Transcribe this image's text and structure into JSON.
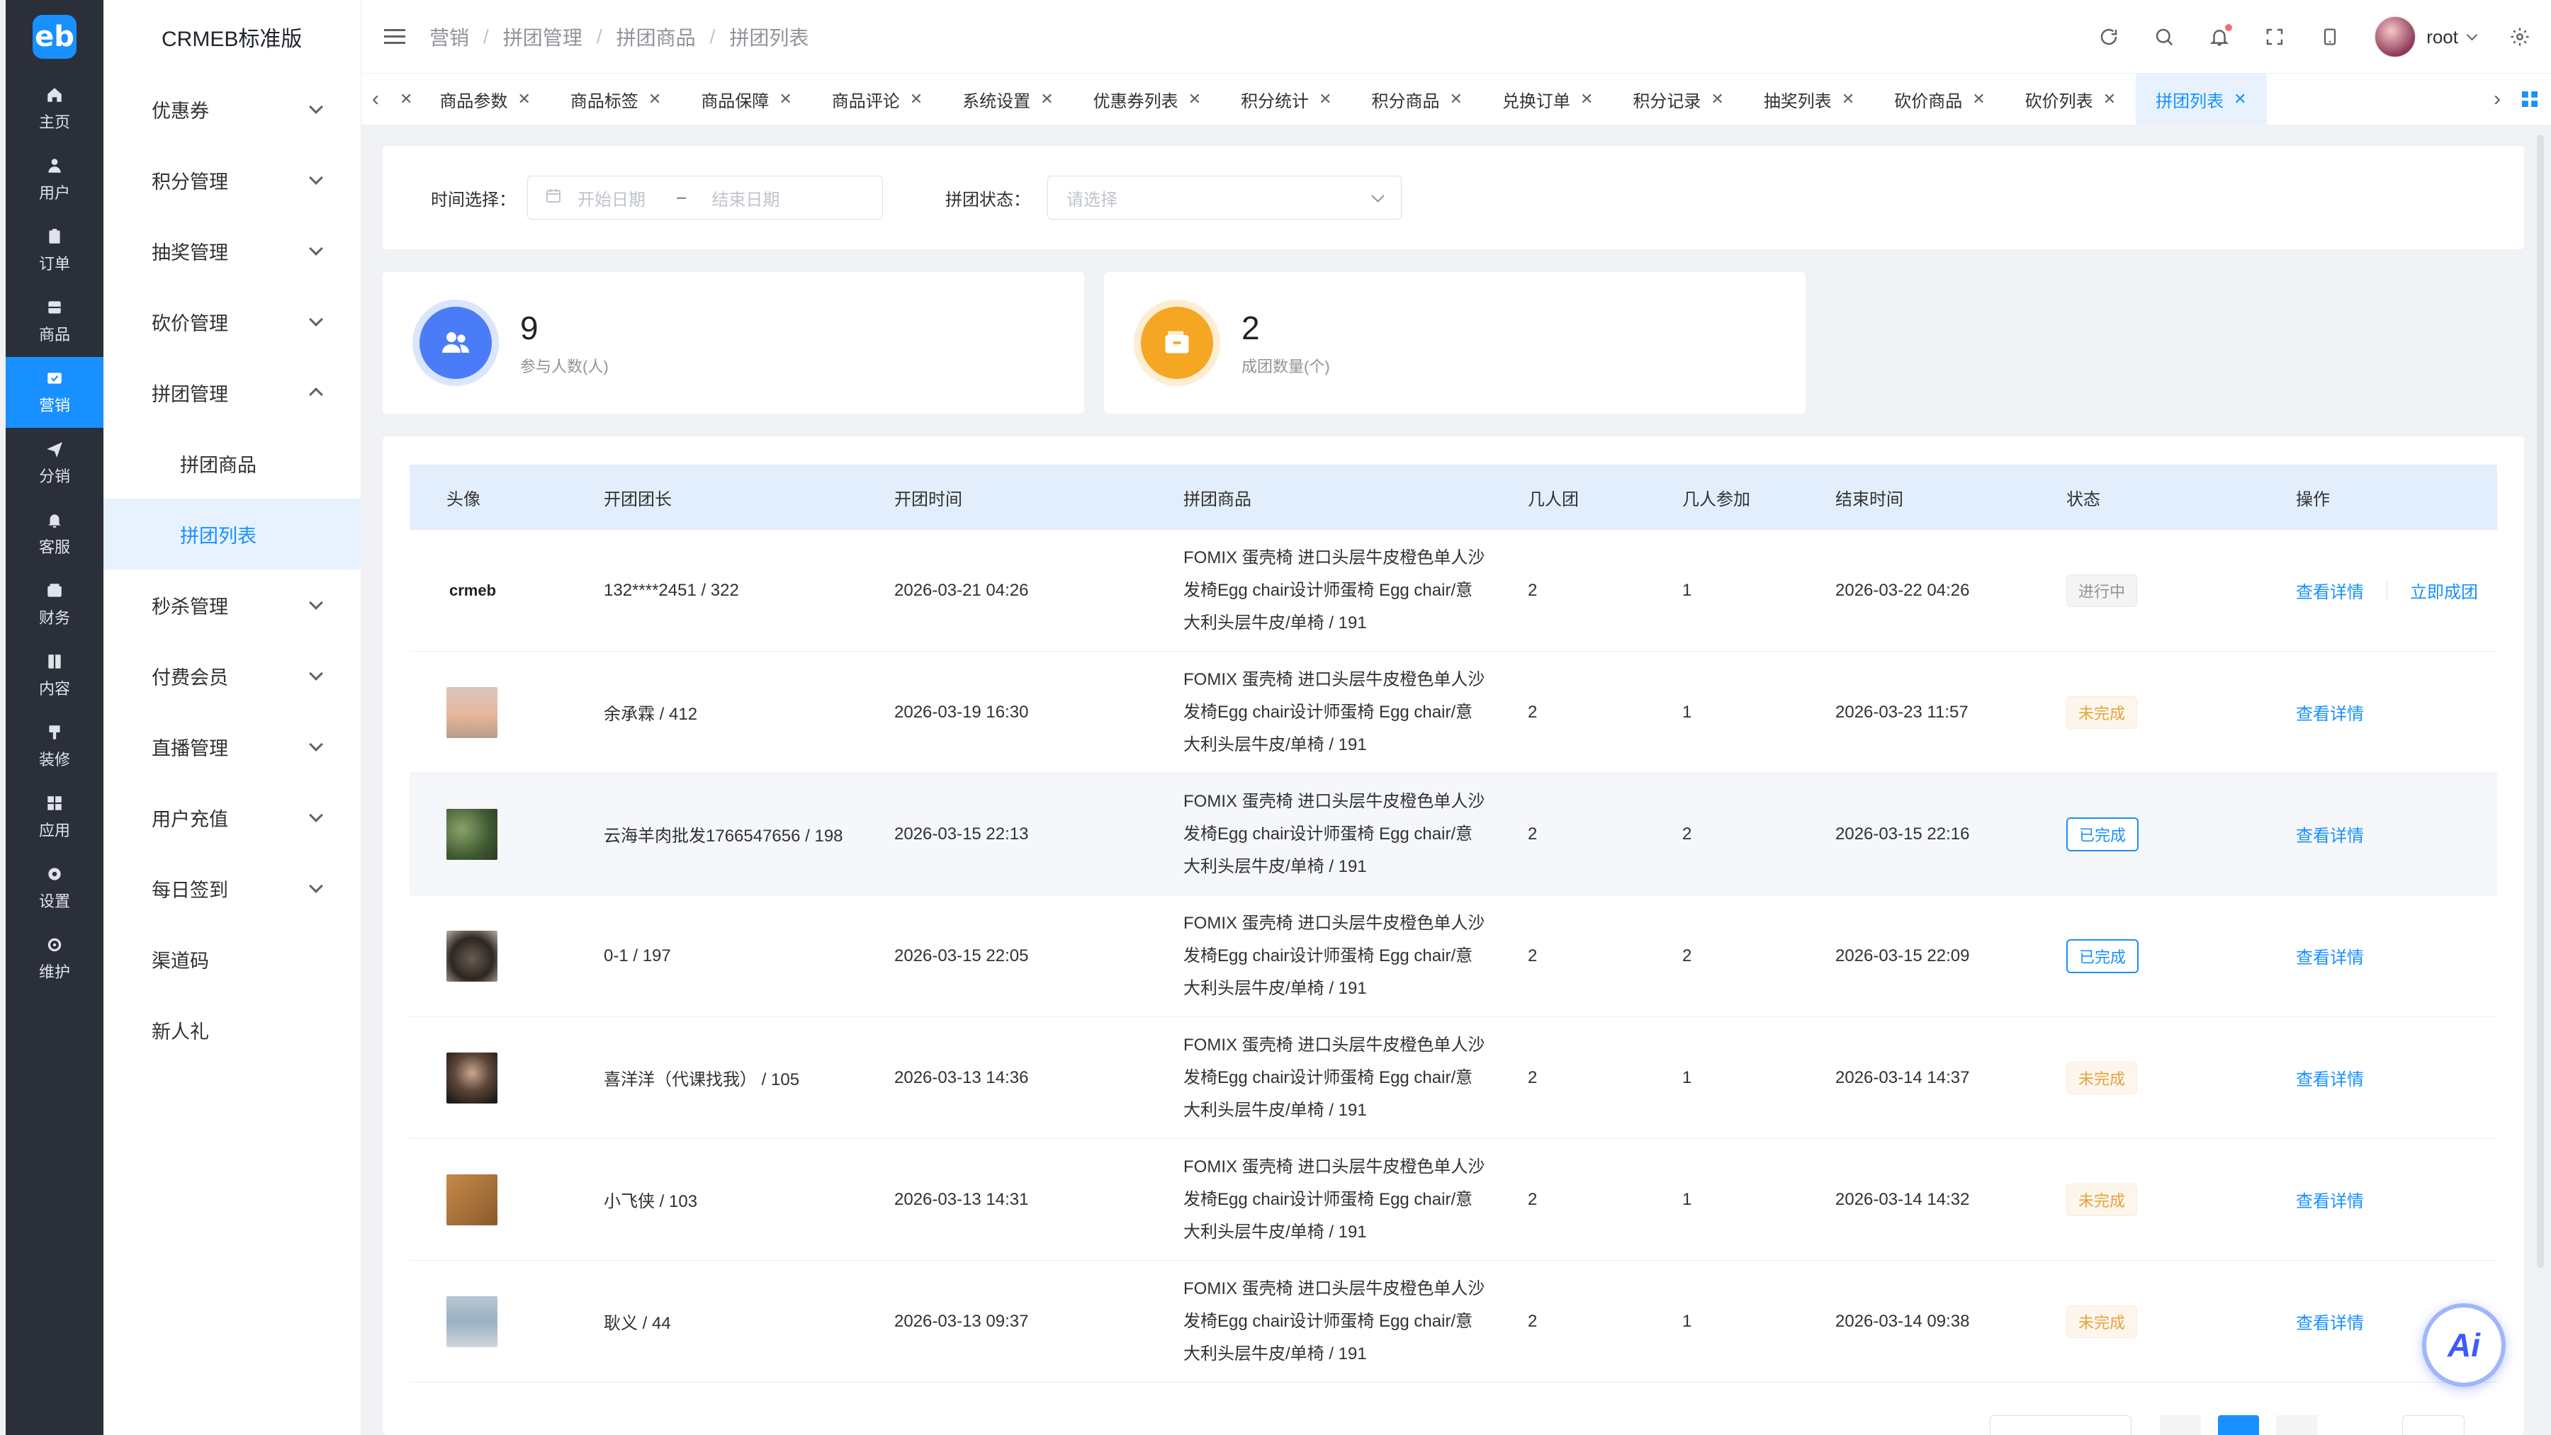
{
  "brand": {
    "logo_text": "eb",
    "app_title": "CRMEB标准版"
  },
  "rail": [
    {
      "id": "home",
      "label": "主页",
      "icon": "home-icon"
    },
    {
      "id": "user",
      "label": "用户",
      "icon": "user-icon"
    },
    {
      "id": "order",
      "label": "订单",
      "icon": "clipboard-icon"
    },
    {
      "id": "goods",
      "label": "商品",
      "icon": "box-icon"
    },
    {
      "id": "marketing",
      "label": "营销",
      "icon": "ticket-icon",
      "active": true
    },
    {
      "id": "distribution",
      "label": "分销",
      "icon": "send-icon"
    },
    {
      "id": "service",
      "label": "客服",
      "icon": "bell-icon"
    },
    {
      "id": "finance",
      "label": "财务",
      "icon": "wallet-icon"
    },
    {
      "id": "content",
      "label": "内容",
      "icon": "book-icon"
    },
    {
      "id": "decorate",
      "label": "装修",
      "icon": "brush-icon"
    },
    {
      "id": "apps",
      "label": "应用",
      "icon": "grid-icon"
    },
    {
      "id": "settings",
      "label": "设置",
      "icon": "gear-icon"
    },
    {
      "id": "maintain",
      "label": "维护",
      "icon": "cog-outline-icon"
    }
  ],
  "sidebar": {
    "items": [
      {
        "label": "优惠券",
        "expandable": true
      },
      {
        "label": "积分管理",
        "expandable": true
      },
      {
        "label": "抽奖管理",
        "expandable": true
      },
      {
        "label": "砍价管理",
        "expandable": true
      },
      {
        "label": "拼团管理",
        "expandable": true,
        "open": true
      },
      {
        "label": "拼团商品",
        "sub": true
      },
      {
        "label": "拼团列表",
        "sub": true,
        "active": true
      },
      {
        "label": "秒杀管理",
        "expandable": true
      },
      {
        "label": "付费会员",
        "expandable": true
      },
      {
        "label": "直播管理",
        "expandable": true
      },
      {
        "label": "用户充值",
        "expandable": true
      },
      {
        "label": "每日签到",
        "expandable": true
      },
      {
        "label": "渠道码"
      },
      {
        "label": "新人礼"
      }
    ]
  },
  "header": {
    "breadcrumb": [
      "营销",
      "拼团管理",
      "拼团商品",
      "拼团列表"
    ],
    "username": "root"
  },
  "tabs": {
    "items": [
      {
        "label": "商品参数"
      },
      {
        "label": "商品标签"
      },
      {
        "label": "商品保障"
      },
      {
        "label": "商品评论"
      },
      {
        "label": "系统设置"
      },
      {
        "label": "优惠券列表"
      },
      {
        "label": "积分统计"
      },
      {
        "label": "积分商品"
      },
      {
        "label": "兑换订单"
      },
      {
        "label": "积分记录"
      },
      {
        "label": "抽奖列表"
      },
      {
        "label": "砍价商品"
      },
      {
        "label": "砍价列表"
      },
      {
        "label": "拼团列表",
        "active": true
      }
    ]
  },
  "filter": {
    "time_label": "时间选择：",
    "start_placeholder": "开始日期",
    "end_placeholder": "结束日期",
    "range_sep": "–",
    "status_label": "拼团状态：",
    "status_placeholder": "请选择"
  },
  "stats": [
    {
      "value": "9",
      "label": "参与人数(人)",
      "color": "#4a7cf7",
      "icon": "users-icon"
    },
    {
      "value": "2",
      "label": "成团数量(个)",
      "color": "#f5a623",
      "icon": "wallet-icon"
    }
  ],
  "table": {
    "columns": [
      "头像",
      "开团团长",
      "开团时间",
      "拼团商品",
      "几人团",
      "几人参加",
      "结束时间",
      "状态",
      "操作"
    ],
    "rows": [
      {
        "avatar": "crmeb-logo",
        "leader": "132****2451 / 322",
        "start": "2026-03-21 04:26",
        "product": [
          "FOMIX 蛋壳椅 进口头层牛皮橙色单人沙",
          "发椅Egg chair设计师蛋椅 Egg chair/意",
          "大利头层牛皮/单椅 / 191"
        ],
        "team_size": "2",
        "joined": "1",
        "end": "2026-03-22 04:26",
        "status": "进行中",
        "status_type": "going",
        "actions": [
          "查看详情",
          "立即成团"
        ]
      },
      {
        "avatar": "photo-sunset",
        "leader": "余承霖 / 412",
        "start": "2026-03-19 16:30",
        "product": [
          "FOMIX 蛋壳椅 进口头层牛皮橙色单人沙",
          "发椅Egg chair设计师蛋椅 Egg chair/意",
          "大利头层牛皮/单椅 / 191"
        ],
        "team_size": "2",
        "joined": "1",
        "end": "2026-03-23 11:57",
        "status": "未完成",
        "status_type": "pending",
        "actions": [
          "查看详情"
        ]
      },
      {
        "avatar": "photo-greenery",
        "leader": "云海羊肉批发1766547656 / 198",
        "start": "2026-03-15 22:13",
        "product": [
          "FOMIX 蛋壳椅 进口头层牛皮橙色单人沙",
          "发椅Egg chair设计师蛋椅 Egg chair/意",
          "大利头层牛皮/单椅 / 191"
        ],
        "team_size": "2",
        "joined": "2",
        "end": "2026-03-15 22:16",
        "status": "已完成",
        "status_type": "done",
        "actions": [
          "查看详情"
        ]
      },
      {
        "avatar": "photo-cat",
        "leader": "0-1 / 197",
        "start": "2026-03-15 22:05",
        "product": [
          "FOMIX 蛋壳椅 进口头层牛皮橙色单人沙",
          "发椅Egg chair设计师蛋椅 Egg chair/意",
          "大利头层牛皮/单椅 / 191"
        ],
        "team_size": "2",
        "joined": "2",
        "end": "2026-03-15 22:09",
        "status": "已完成",
        "status_type": "done",
        "actions": [
          "查看详情"
        ]
      },
      {
        "avatar": "photo-person",
        "leader": "喜洋洋（代课找我） / 105",
        "start": "2026-03-13 14:36",
        "product": [
          "FOMIX 蛋壳椅 进口头层牛皮橙色单人沙",
          "发椅Egg chair设计师蛋椅 Egg chair/意",
          "大利头层牛皮/单椅 / 191"
        ],
        "team_size": "2",
        "joined": "1",
        "end": "2026-03-14 14:37",
        "status": "未完成",
        "status_type": "pending",
        "actions": [
          "查看详情"
        ]
      },
      {
        "avatar": "photo-box",
        "leader": "小飞侠 / 103",
        "start": "2026-03-13 14:31",
        "product": [
          "FOMIX 蛋壳椅 进口头层牛皮橙色单人沙",
          "发椅Egg chair设计师蛋椅 Egg chair/意",
          "大利头层牛皮/单椅 / 191"
        ],
        "team_size": "2",
        "joined": "1",
        "end": "2026-03-14 14:32",
        "status": "未完成",
        "status_type": "pending",
        "actions": [
          "查看详情"
        ]
      },
      {
        "avatar": "photo-beach",
        "leader": "耿义 / 44",
        "start": "2026-03-13 09:37",
        "product": [
          "FOMIX 蛋壳椅 进口头层牛皮橙色单人沙",
          "发椅Egg chair设计师蛋椅 Egg chair/意",
          "大利头层牛皮/单椅 / 191"
        ],
        "team_size": "2",
        "joined": "1",
        "end": "2026-03-14 09:38",
        "status": "未完成",
        "status_type": "pending",
        "actions": [
          "查看详情"
        ]
      }
    ]
  },
  "ai_button": {
    "label": "Ai"
  },
  "colors": {
    "primary": "#1890ff",
    "rail_bg": "#2b2f3a",
    "pending": "#e6a23c"
  }
}
